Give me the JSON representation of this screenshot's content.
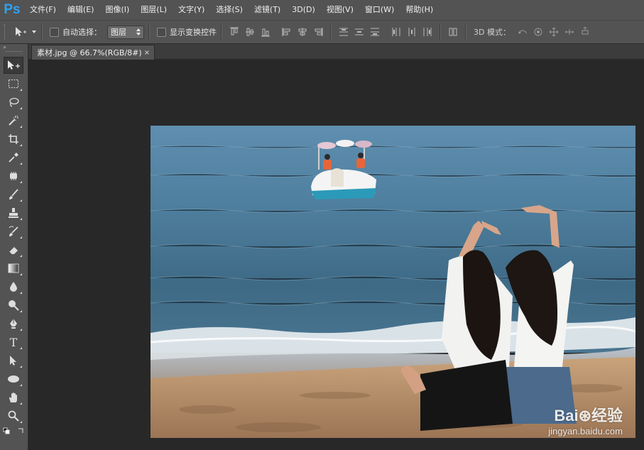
{
  "app": {
    "logo": "Ps"
  },
  "menu": [
    {
      "label": "文件(F)"
    },
    {
      "label": "编辑(E)"
    },
    {
      "label": "图像(I)"
    },
    {
      "label": "图层(L)"
    },
    {
      "label": "文字(Y)"
    },
    {
      "label": "选择(S)"
    },
    {
      "label": "滤镜(T)"
    },
    {
      "label": "3D(D)"
    },
    {
      "label": "视图(V)"
    },
    {
      "label": "窗口(W)"
    },
    {
      "label": "帮助(H)"
    }
  ],
  "options": {
    "auto_select_label": "自动选择：",
    "auto_select_value": "图层",
    "auto_select_checked": false,
    "show_transform_label": "显示变换控件",
    "show_transform_checked": false,
    "mode_3d_label": "3D 模式："
  },
  "document": {
    "tab_title": "素材.jpg @ 66.7%(RGB/8#)",
    "close_glyph": "×"
  },
  "watermark": {
    "brand": "Bai⊛经验",
    "url": "jingyan.baidu.com"
  },
  "tools": [
    {
      "name": "move-tool",
      "active": true
    },
    {
      "name": "rectangular-marquee-tool"
    },
    {
      "name": "lasso-tool"
    },
    {
      "name": "magic-wand-tool"
    },
    {
      "name": "crop-tool"
    },
    {
      "name": "eyedropper-tool"
    },
    {
      "name": "spot-healing-brush-tool"
    },
    {
      "name": "brush-tool"
    },
    {
      "name": "clone-stamp-tool"
    },
    {
      "name": "history-brush-tool"
    },
    {
      "name": "eraser-tool"
    },
    {
      "name": "gradient-tool"
    },
    {
      "name": "blur-tool"
    },
    {
      "name": "dodge-tool"
    },
    {
      "name": "pen-tool"
    },
    {
      "name": "type-tool",
      "glyph": "T"
    },
    {
      "name": "path-selection-tool"
    },
    {
      "name": "ellipse-tool"
    },
    {
      "name": "hand-tool"
    },
    {
      "name": "zoom-tool"
    }
  ],
  "colors": {
    "ui_bg": "#535353",
    "canvas_bg": "#282828",
    "ps_blue": "#2ea3f2"
  }
}
